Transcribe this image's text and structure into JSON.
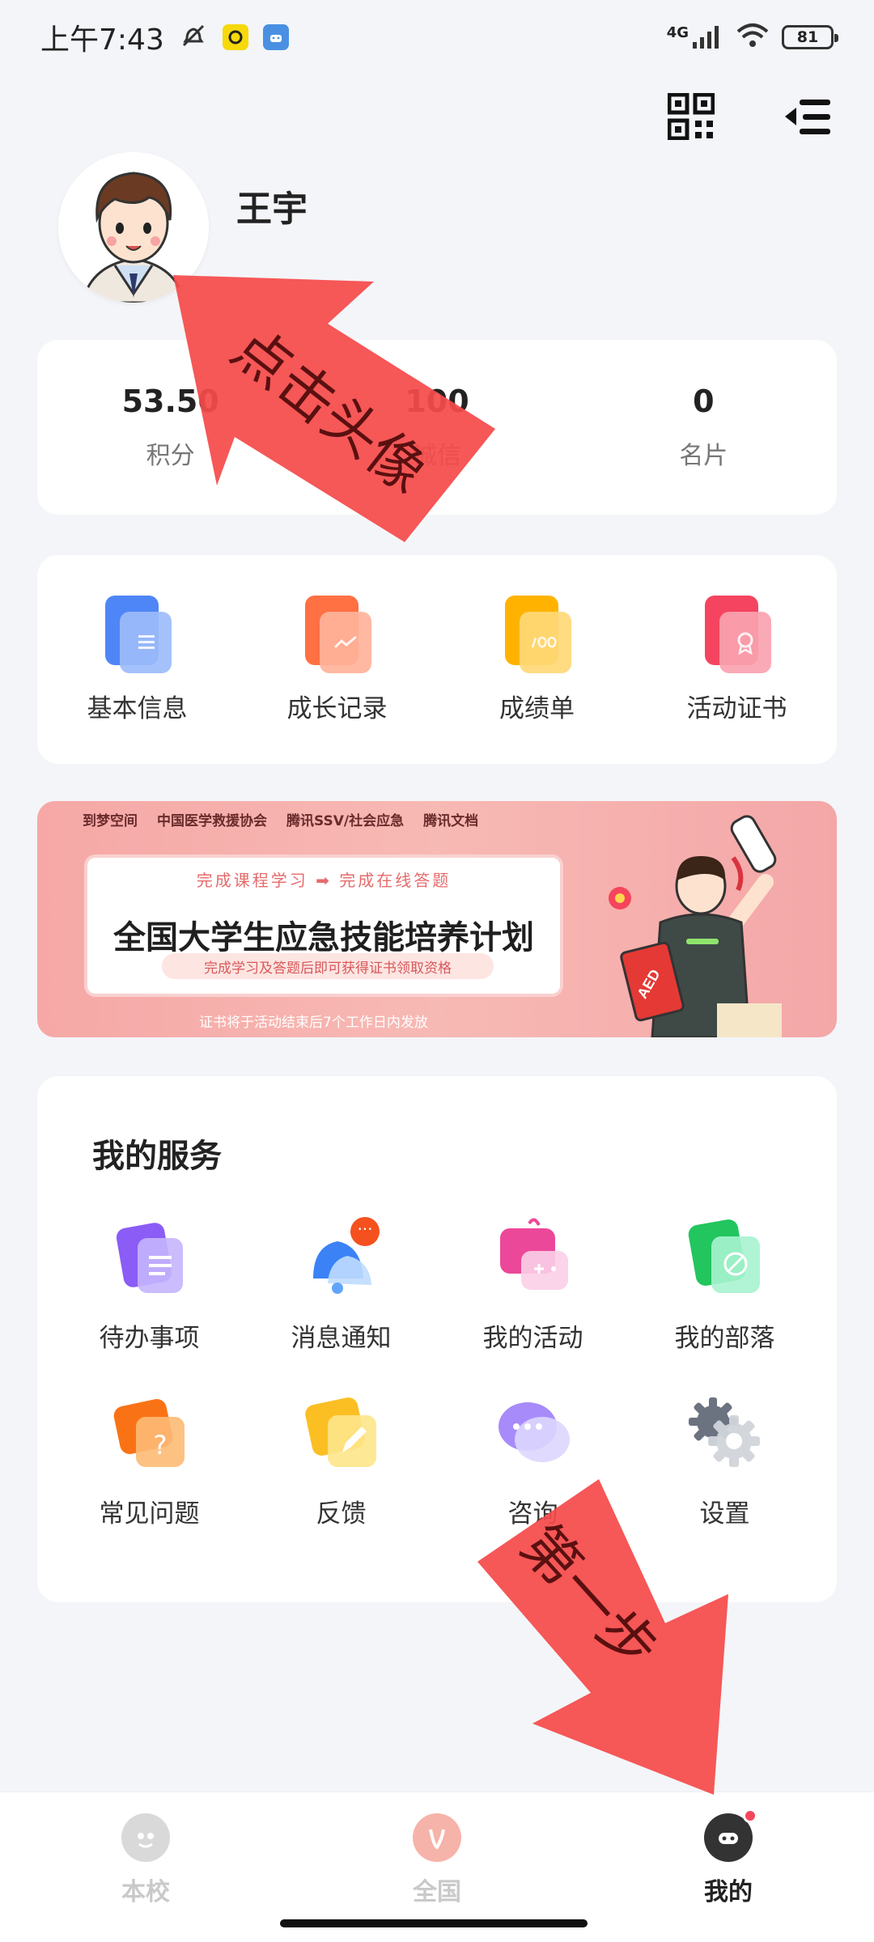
{
  "status_bar": {
    "time": "上午7:43",
    "network": "4G",
    "battery": "81"
  },
  "profile": {
    "name": "王宇"
  },
  "stats": [
    {
      "value": "53.50",
      "label": "积分"
    },
    {
      "value": "100",
      "label": "诚信"
    },
    {
      "value": "0",
      "label": "名片"
    }
  ],
  "quick_menu": [
    {
      "label": "基本信息",
      "icon": "document-icon",
      "color": "#5b8ff9"
    },
    {
      "label": "成长记录",
      "icon": "chart-icon",
      "color": "#ff7a45"
    },
    {
      "label": "成绩单",
      "icon": "score-icon",
      "color": "#ffc53d"
    },
    {
      "label": "活动证书",
      "icon": "certificate-icon",
      "color": "#f5576c"
    }
  ],
  "banner": {
    "orgs": [
      "到梦空间",
      "中国医学救援协会",
      "腾讯SSV/社会应急",
      "腾讯文档"
    ],
    "steps": "完成课程学习  ➡  完成在线答题",
    "title": "全国大学生应急技能培养计划",
    "subtitle": "完成学习及答题后即可获得证书领取资格",
    "footnote": "证书将于活动结束后7个工作日内发放",
    "badge": "AED"
  },
  "services": {
    "title": "我的服务",
    "items": [
      {
        "label": "待办事项",
        "icon": "todo-icon"
      },
      {
        "label": "消息通知",
        "icon": "bell-icon",
        "badge": "···"
      },
      {
        "label": "我的活动",
        "icon": "activity-icon"
      },
      {
        "label": "我的部落",
        "icon": "tribe-icon"
      },
      {
        "label": "常见问题",
        "icon": "question-icon"
      },
      {
        "label": "反馈",
        "icon": "feedback-icon"
      },
      {
        "label": "咨询",
        "icon": "chat-icon"
      },
      {
        "label": "设置",
        "icon": "gear-icon"
      }
    ]
  },
  "tabs": [
    {
      "label": "本校",
      "icon": "school-icon"
    },
    {
      "label": "全国",
      "icon": "national-icon"
    },
    {
      "label": "我的",
      "icon": "mine-icon",
      "active": true
    }
  ],
  "annotations": {
    "arrow1": "点击头像",
    "arrow2": "第一步"
  }
}
